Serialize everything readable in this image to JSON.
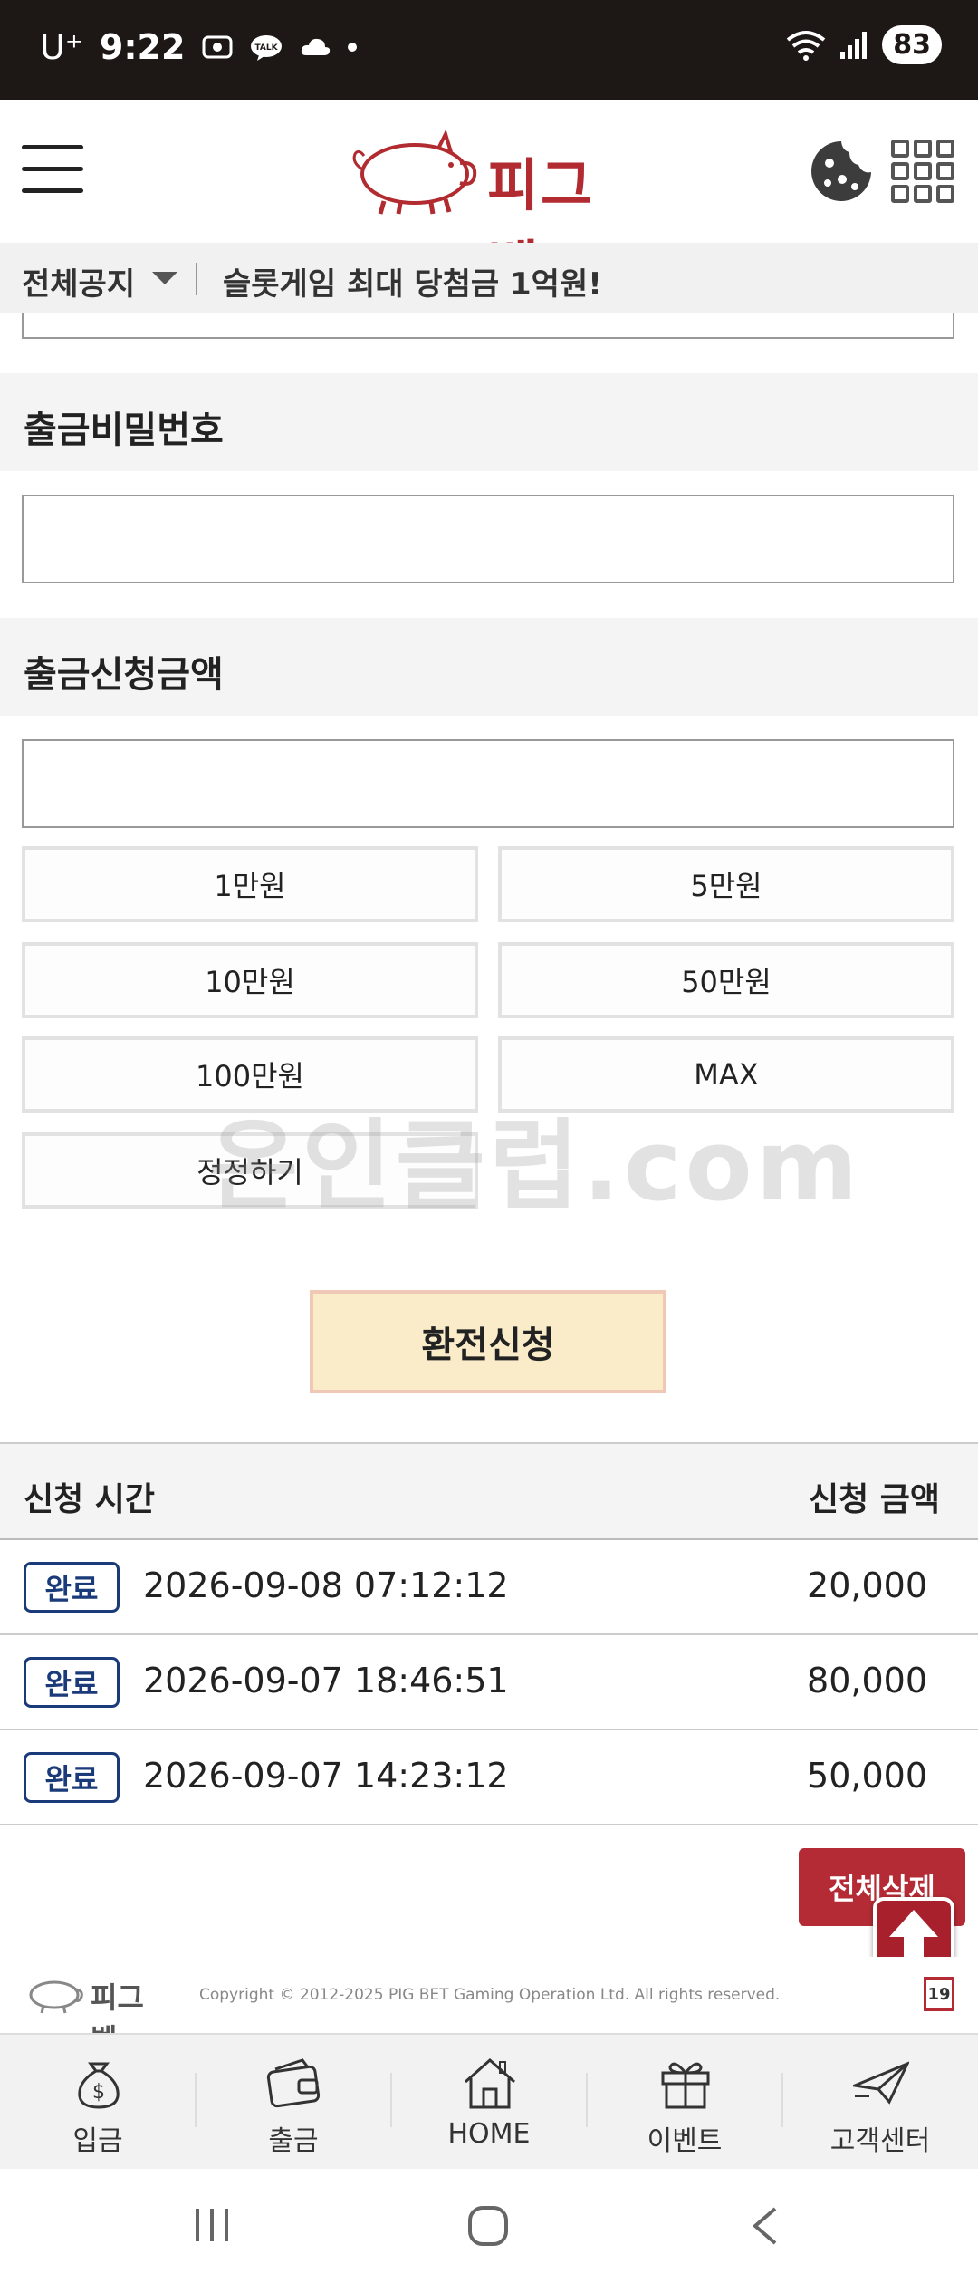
{
  "status_bar": {
    "carrier": "U⁺",
    "time": "9:22",
    "battery": "83"
  },
  "header": {
    "logo_text": "피그벳",
    "menu_icon": "hamburger-menu-icon",
    "cookie_icon": "cookie-icon",
    "apps_icon": "grid-apps-icon"
  },
  "notice": {
    "category": "전체공지",
    "text": "슬롯게임 최대 당첨금 1억원!"
  },
  "form": {
    "password_label": "출금비밀번호",
    "password_value": "",
    "amount_label": "출금신청금액",
    "amount_value": "",
    "amount_buttons": [
      "1만원",
      "5만원",
      "10만원",
      "50만원",
      "100만원",
      "MAX",
      "정정하기"
    ],
    "submit_label": "환전신청"
  },
  "watermark": "온인클럽.com",
  "history": {
    "col_time": "신청 시간",
    "col_amount": "신청 금액",
    "rows": [
      {
        "status": "완료",
        "time": "2026-09-08 07:12:12",
        "amount": "20,000"
      },
      {
        "status": "완료",
        "time": "2026-09-07 18:46:51",
        "amount": "80,000"
      },
      {
        "status": "완료",
        "time": "2026-09-07 14:23:12",
        "amount": "50,000"
      }
    ],
    "delete_all_label": "전체삭제"
  },
  "footer": {
    "logo_text": "피그벳",
    "copyright": "Copyright © 2012-2025 PIG BET Gaming Operation Ltd. All rights reserved.",
    "age_badge": "19"
  },
  "bottom_nav": [
    {
      "label": "입금",
      "icon": "money-bag-icon"
    },
    {
      "label": "출금",
      "icon": "wallet-icon"
    },
    {
      "label": "HOME",
      "icon": "home-icon"
    },
    {
      "label": "이벤트",
      "icon": "gift-icon"
    },
    {
      "label": "고객센터",
      "icon": "paper-plane-icon"
    }
  ],
  "colors": {
    "brand_red": "#b52b35",
    "submit_bg": "#faecc9",
    "badge_blue": "#1a3a7a",
    "status_bar": "#1d1716"
  }
}
